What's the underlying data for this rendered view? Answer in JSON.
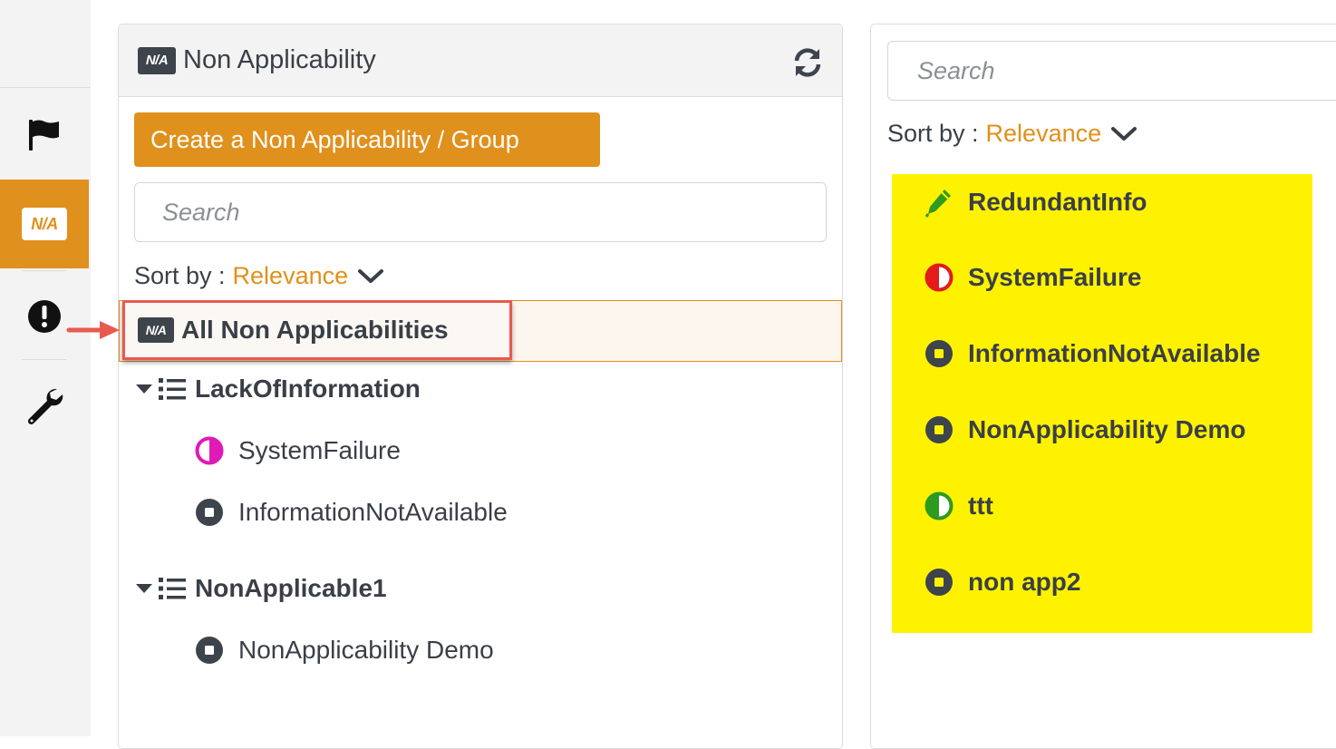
{
  "sidebar": {
    "items": [
      {
        "name": "flag-icon",
        "active": false
      },
      {
        "name": "na-icon",
        "label": "N/A",
        "active": true
      },
      {
        "name": "alert-icon",
        "active": false
      },
      {
        "name": "wrench-icon",
        "active": false
      }
    ]
  },
  "panel": {
    "badge": "N/A",
    "title": "Non Applicability",
    "create_button": "Create a Non Applicability / Group",
    "search_placeholder": "Search",
    "sort_label": "Sort by :",
    "sort_value": "Relevance",
    "all_item": {
      "badge": "N/A",
      "label": "All Non Applicabilities"
    },
    "groups": [
      {
        "label": "LackOfInformation",
        "items": [
          {
            "label": "SystemFailure",
            "icon": "half-circle-icon",
            "color": "#e01ab5"
          },
          {
            "label": "InformationNotAvailable",
            "icon": "square-circle-icon",
            "color": "#3e444c"
          }
        ]
      },
      {
        "label": "NonApplicable1",
        "items": [
          {
            "label": "NonApplicability Demo",
            "icon": "square-circle-icon",
            "color": "#3e444c"
          }
        ]
      }
    ]
  },
  "results": {
    "search_placeholder": "Search",
    "sort_label": "Sort by :",
    "sort_value": "Relevance",
    "items": [
      {
        "label": "RedundantInfo",
        "icon": "pen-icon",
        "color": "#2e9a1e"
      },
      {
        "label": "SystemFailure",
        "icon": "half-circle-icon",
        "color": "#e31b1b"
      },
      {
        "label": "InformationNotAvailable",
        "icon": "square-circle-icon",
        "color": "#3e444c"
      },
      {
        "label": "NonApplicability Demo",
        "icon": "square-circle-icon",
        "color": "#3e444c"
      },
      {
        "label": "ttt",
        "icon": "half-circle-icon",
        "color": "#2e9a1e"
      },
      {
        "label": "non app2",
        "icon": "square-circle-icon",
        "color": "#3e444c"
      }
    ]
  },
  "colors": {
    "accent": "#e0901c",
    "highlight": "#fff200",
    "callout": "#e85a4f"
  }
}
